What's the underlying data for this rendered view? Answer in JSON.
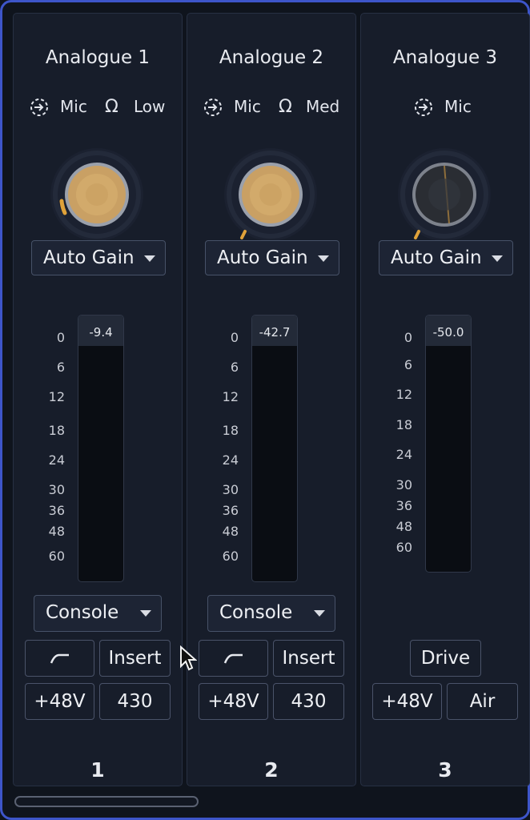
{
  "channels": [
    {
      "title": "Analogue 1",
      "input_label": "Mic",
      "impedance_label": "Low",
      "auto_gain": "Auto Gain",
      "meter_readout": "-9.4",
      "mode": "Console",
      "filter_button": "",
      "insert_label": "Insert",
      "phantom_label": "+48V",
      "hz_label": "430",
      "number": "1",
      "knob_style": "gold",
      "gain_level": 0.22
    },
    {
      "title": "Analogue 2",
      "input_label": "Mic",
      "impedance_label": "Med",
      "auto_gain": "Auto Gain",
      "meter_readout": "-42.7",
      "mode": "Console",
      "filter_button": "",
      "insert_label": "Insert",
      "phantom_label": "+48V",
      "hz_label": "430",
      "number": "2",
      "knob_style": "gold",
      "gain_level": 0.0
    },
    {
      "title": "Analogue 3",
      "input_label": "Mic",
      "auto_gain": "Auto Gain",
      "meter_readout": "-50.0",
      "drive_label": "Drive",
      "phantom_label": "+48V",
      "air_label": "Air",
      "number": "3",
      "knob_style": "dark",
      "gain_level": 0.0
    }
  ],
  "meter_scale": [
    "0",
    "6",
    "12",
    "18",
    "24",
    "30",
    "36",
    "48",
    "60"
  ],
  "colors": {
    "accent_border": "#3d55c9",
    "gain_arc": "#e0a23a",
    "background": "#0f141d",
    "strip": "#171d2a"
  },
  "icons": {
    "input": "input-arrow-icon",
    "impedance": "omega-icon",
    "dropdown": "caret-down-icon",
    "filter": "high-pass-filter-icon"
  }
}
